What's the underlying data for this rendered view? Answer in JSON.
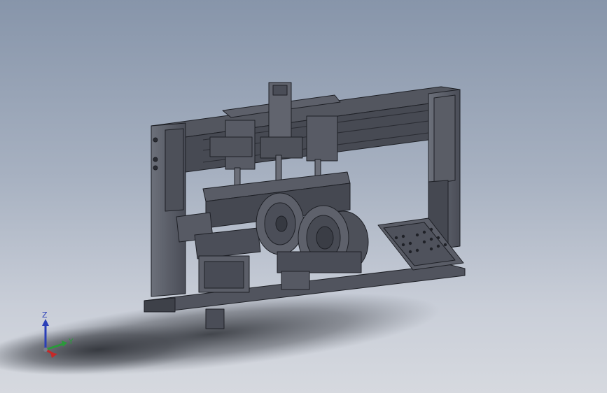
{
  "viewport": {
    "background_top": "#8795aa",
    "background_bottom": "#d6d9df",
    "model_color": "#4a4d57",
    "edge_color": "#1e2026"
  },
  "triad": {
    "z_label": "Z",
    "y_label": "Y",
    "z_color": "#2a3fb8",
    "y_color": "#2a9a3a",
    "x_color": "#c62828"
  }
}
